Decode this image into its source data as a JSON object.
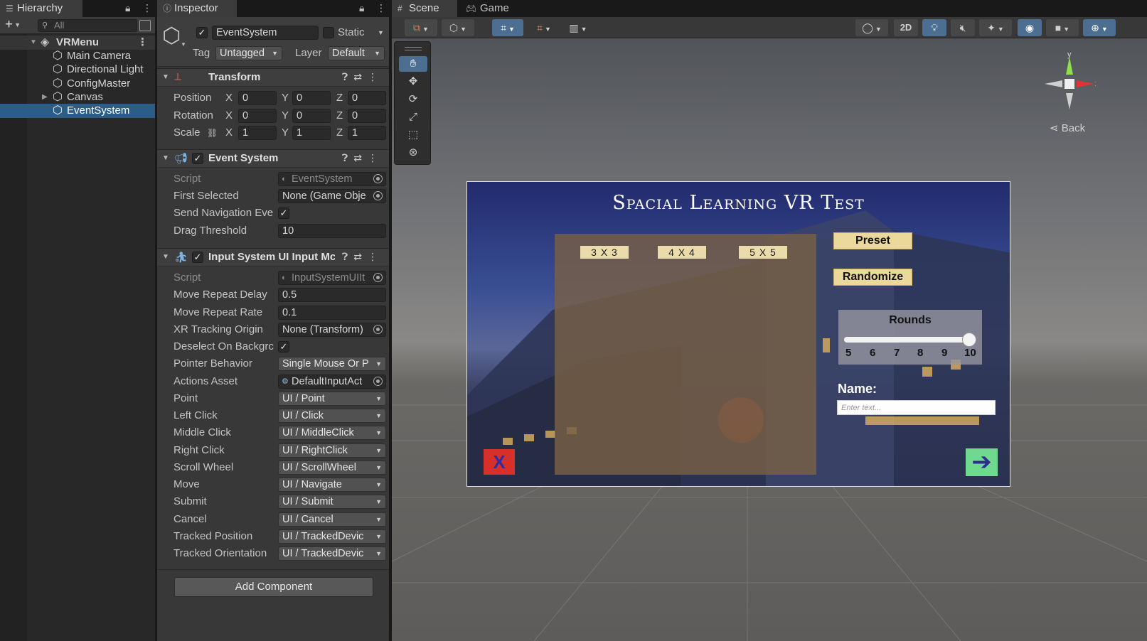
{
  "hierarchy": {
    "tab_label": "Hierarchy",
    "search_placeholder": "All",
    "scene_name": "VRMenu",
    "items": [
      {
        "label": "Main Camera"
      },
      {
        "label": "Directional Light"
      },
      {
        "label": "ConfigMaster"
      },
      {
        "label": "Canvas"
      },
      {
        "label": "EventSystem"
      }
    ],
    "selected": "EventSystem"
  },
  "inspector": {
    "tab_label": "Inspector",
    "object_name": "EventSystem",
    "static_label": "Static",
    "tag_label": "Tag",
    "tag_value": "Untagged",
    "layer_label": "Layer",
    "layer_value": "Default",
    "transform": {
      "title": "Transform",
      "position": {
        "label": "Position",
        "x": "0",
        "y": "0",
        "z": "0"
      },
      "rotation": {
        "label": "Rotation",
        "x": "0",
        "y": "0",
        "z": "0"
      },
      "scale": {
        "label": "Scale",
        "x": "1",
        "y": "1",
        "z": "1"
      },
      "axis_x": "X",
      "axis_y": "Y",
      "axis_z": "Z"
    },
    "event_system": {
      "title": "Event System",
      "rows": [
        {
          "label": "Script",
          "value": "EventSystem"
        },
        {
          "label": "First Selected",
          "value": "None (Game Obje"
        },
        {
          "label": "Send Navigation Eve",
          "value": "✓"
        },
        {
          "label": "Drag Threshold",
          "value": "10"
        }
      ]
    },
    "input_module": {
      "title": "Input System UI Input Mc",
      "rows": [
        {
          "label": "Script",
          "value": "InputSystemUIIt"
        },
        {
          "label": "Move Repeat Delay",
          "value": "0.5"
        },
        {
          "label": "Move Repeat Rate",
          "value": "0.1"
        },
        {
          "label": "XR Tracking Origin",
          "value": "None (Transform)"
        },
        {
          "label": "Deselect On Backgrc",
          "value": "✓"
        },
        {
          "label": "Pointer Behavior",
          "value": "Single Mouse Or P"
        },
        {
          "label": "Actions Asset",
          "value": "DefaultInputAct"
        },
        {
          "label": "Point",
          "value": "UI / Point"
        },
        {
          "label": "Left Click",
          "value": "UI / Click"
        },
        {
          "label": "Middle Click",
          "value": "UI / MiddleClick"
        },
        {
          "label": "Right Click",
          "value": "UI / RightClick"
        },
        {
          "label": "Scroll Wheel",
          "value": "UI / ScrollWheel"
        },
        {
          "label": "Move",
          "value": "UI / Navigate"
        },
        {
          "label": "Submit",
          "value": "UI / Submit"
        },
        {
          "label": "Cancel",
          "value": "UI / Cancel"
        },
        {
          "label": "Tracked Position",
          "value": "UI / TrackedDevic"
        },
        {
          "label": "Tracked Orientation",
          "value": "UI / TrackedDevic"
        }
      ]
    },
    "add_component": "Add Component"
  },
  "scene": {
    "tabs": [
      {
        "label": "Scene"
      },
      {
        "label": "Game"
      }
    ],
    "btn_2d": "2D",
    "gizmo_back": "Back",
    "gizmo_y": "y",
    "gizmo_x": "x",
    "canvas": {
      "title": "Spacial Learning VR Test",
      "size_buttons": [
        "3 X 3",
        "4 X 4",
        "5 X 5"
      ],
      "preset": "Preset",
      "randomize": "Randomize",
      "rounds_title": "Rounds",
      "rounds_ticks": [
        "5",
        "6",
        "7",
        "8",
        "9",
        "10"
      ],
      "rounds_value": 10,
      "name_label": "Name:",
      "name_placeholder": "Enter text...",
      "cancel_glyph": "X",
      "next_glyph": "➔"
    }
  },
  "colors": {
    "selection": "#2c5d87",
    "toggle_on": "#4c6f91",
    "button_fill": "#ead99b",
    "cancel_red": "#d7302a",
    "next_green": "#6fd98f"
  }
}
